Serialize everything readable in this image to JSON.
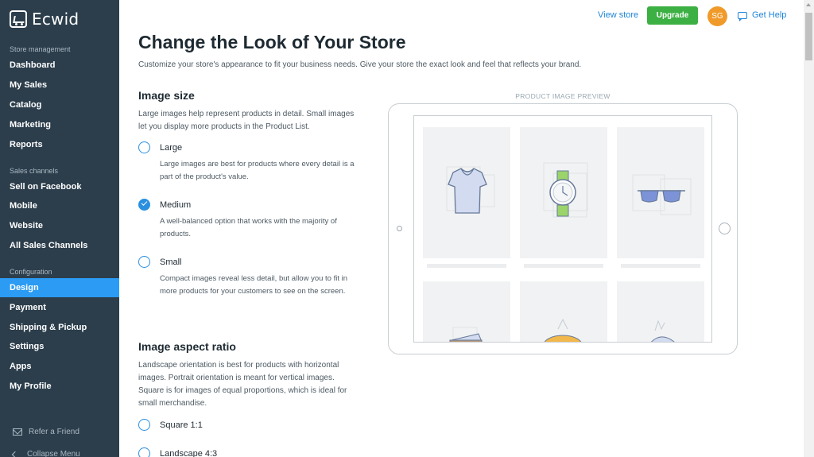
{
  "app": {
    "name": "Ecwid"
  },
  "sidebar": {
    "sections": [
      {
        "label": "Store management",
        "items": [
          "Dashboard",
          "My Sales",
          "Catalog",
          "Marketing",
          "Reports"
        ]
      },
      {
        "label": "Sales channels",
        "items": [
          "Sell on Facebook",
          "Mobile",
          "Website",
          "All Sales Channels"
        ]
      },
      {
        "label": "Configuration",
        "items": [
          "Design",
          "Payment",
          "Shipping & Pickup",
          "Settings",
          "Apps",
          "My Profile"
        ]
      }
    ],
    "active_item": "Design",
    "refer": "Refer a Friend",
    "collapse": "Collapse Menu"
  },
  "header": {
    "view_store": "View store",
    "upgrade": "Upgrade",
    "avatar_initials": "SG",
    "help": "Get Help"
  },
  "page": {
    "title": "Change the Look of Your Store",
    "subtitle": "Customize your store's appearance to fit your business needs. Give your store the exact look and feel that reflects your brand."
  },
  "image_size": {
    "heading": "Image size",
    "description": "Large images help represent products in detail. Small images let you display more products in the Product List.",
    "options": [
      {
        "label": "Large",
        "description": "Large images are best for products where every detail is a part of the product's value.",
        "checked": false
      },
      {
        "label": "Medium",
        "description": "A well-balanced option that works with the majority of products.",
        "checked": true
      },
      {
        "label": "Small",
        "description": "Compact images reveal less detail, but allow you to fit in more products for your customers to see on the screen.",
        "checked": false
      }
    ]
  },
  "aspect_ratio": {
    "heading": "Image aspect ratio",
    "description": "Landscape orientation is best for products with horizontal images. Portrait orientation is meant for vertical images. Square is for images of equal proportions, which is ideal for small merchandise.",
    "options": [
      {
        "label": "Square 1:1",
        "checked": false
      },
      {
        "label": "Landscape 4:3",
        "checked": false
      }
    ]
  },
  "preview": {
    "label": "PRODUCT IMAGE PREVIEW",
    "products": [
      "tshirt-icon",
      "watch-icon",
      "sunglasses-icon",
      "wallet-icon",
      "bag-icon",
      "cap-icon"
    ]
  },
  "colors": {
    "sidebar_bg": "#2c3e4c",
    "active_bg": "#2b9bf4",
    "accent": "#1d84d8",
    "upgrade_green": "#3cb043",
    "avatar_orange": "#f09a2a"
  }
}
